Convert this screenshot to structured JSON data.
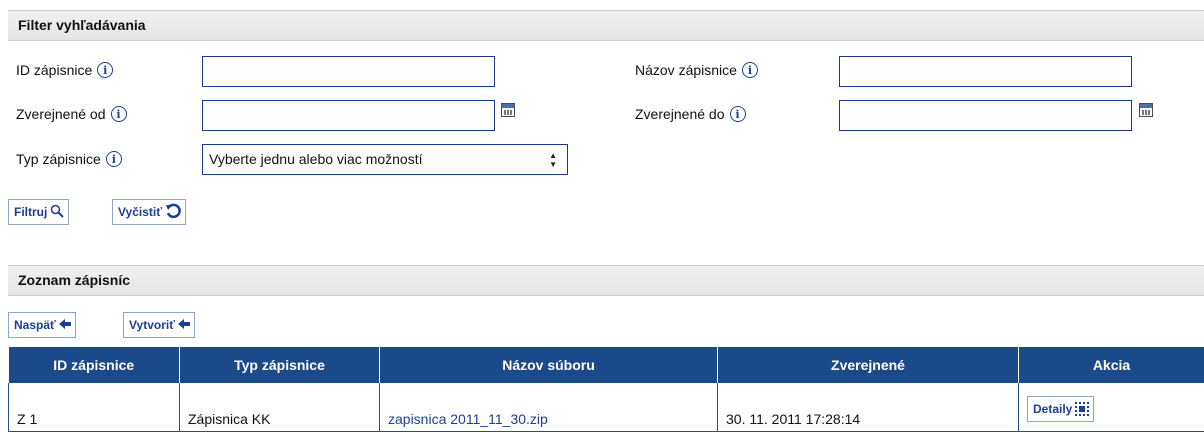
{
  "filter": {
    "header": "Filter vyhľadávania",
    "fields": {
      "id_label": "ID zápisnice",
      "id_value": "",
      "nazov_label": "Názov zápisnice",
      "nazov_value": "",
      "od_label": "Zverejnené od",
      "od_value": "",
      "do_label": "Zverejnené do",
      "do_value": "",
      "typ_label": "Typ zápisnice",
      "typ_selected": "Vyberte jednu alebo viac možností"
    },
    "info_glyph": "i",
    "buttons": {
      "filter_label": "Filtruj",
      "clear_label": "Vyčistiť"
    }
  },
  "list": {
    "header": "Zoznam zápisníc",
    "buttons": {
      "back_label": "Naspäť",
      "create_label": "Vytvoriť"
    },
    "columns": [
      "ID zápisnice",
      "Typ zápisnice",
      "Názov súboru",
      "Zverejnené",
      "Akcia"
    ],
    "rows": [
      {
        "id": "Z 1",
        "typ": "Zápisnica KK",
        "subor": "zapisnica 2011_11_30.zip",
        "zverejnene": "30. 11. 2011 17:28:14",
        "akcia": "Detaily"
      }
    ]
  },
  "icons": {
    "info": "info-icon",
    "calendar": "calendar-icon",
    "search": "search-icon",
    "refresh": "refresh-icon",
    "back": "arrow-left-icon",
    "detail": "detail-icon"
  },
  "colors": {
    "table_header": "#1b4a8a",
    "link": "#1c3f94",
    "border": "#1b3a8f"
  }
}
